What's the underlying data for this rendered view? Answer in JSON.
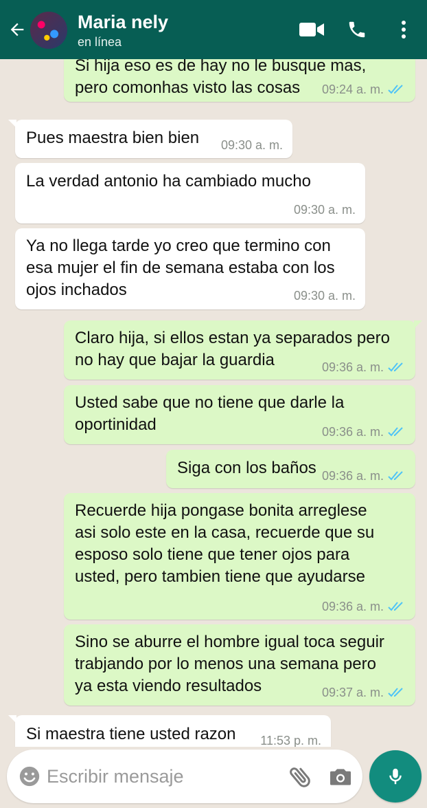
{
  "header": {
    "contact_name": "Maria nely",
    "status": "en línea"
  },
  "messages": [
    {
      "direction": "out",
      "lines": [
        "Si hija eso es de hay no le busque mas,",
        "pero comonhas visto las cosas"
      ],
      "time": "09:24 a. m.",
      "read": true
    },
    {
      "direction": "in",
      "lines": [
        "Pues maestra bien bien"
      ],
      "time": "09:30 a. m."
    },
    {
      "direction": "in",
      "lines": [
        "La verdad antonio ha cambiado mucho"
      ],
      "time": "09:30 a. m."
    },
    {
      "direction": "in",
      "lines": [
        "Ya no llega tarde yo creo que termino con",
        "esa mujer el fin de semana estaba con los",
        "ojos inchados"
      ],
      "time": "09:30 a. m."
    },
    {
      "direction": "out",
      "lines": [
        "Claro hija, si ellos estan ya separados pero",
        "no hay que bajar la guardia"
      ],
      "time": "09:36 a. m.",
      "read": true
    },
    {
      "direction": "out",
      "lines": [
        "Usted sabe que no tiene que darle la",
        "oportinidad"
      ],
      "time": "09:36 a. m.",
      "read": true
    },
    {
      "direction": "out",
      "lines": [
        "Siga con los baños"
      ],
      "time": "09:36 a. m.",
      "read": true
    },
    {
      "direction": "out",
      "lines": [
        "Recuerde hija pongase bonita  arreglese",
        "asi solo este en la casa, recuerde que su",
        "esposo solo tiene que tener ojos para",
        "usted, pero tambien tiene que ayudarse"
      ],
      "time": "09:36 a. m.",
      "read": true
    },
    {
      "direction": "out",
      "lines": [
        "Sino se aburre el hombre igual toca seguir",
        "trabjando por lo menos una semana pero",
        "ya esta viendo resultados"
      ],
      "time": "09:37 a. m.",
      "read": true
    },
    {
      "direction": "in",
      "lines": [
        "Si maestra tiene usted razon"
      ],
      "time": "11:53 p. m."
    }
  ],
  "composer": {
    "placeholder": "Escribir mensaje"
  },
  "icons": {
    "back": "arrow-left-icon",
    "video": "video-camera-icon",
    "call": "phone-icon",
    "menu": "more-vert-icon",
    "emoji": "smiley-icon",
    "attach": "paperclip-icon",
    "camera": "camera-icon",
    "mic": "microphone-icon"
  },
  "colors": {
    "header": "#075E54",
    "outgoing_bubble": "#DCF8C6",
    "incoming_bubble": "#FFFFFF",
    "read_ticks": "#4FC3F7",
    "mic_button": "#128C7E",
    "chat_background": "#ECE5DD"
  }
}
